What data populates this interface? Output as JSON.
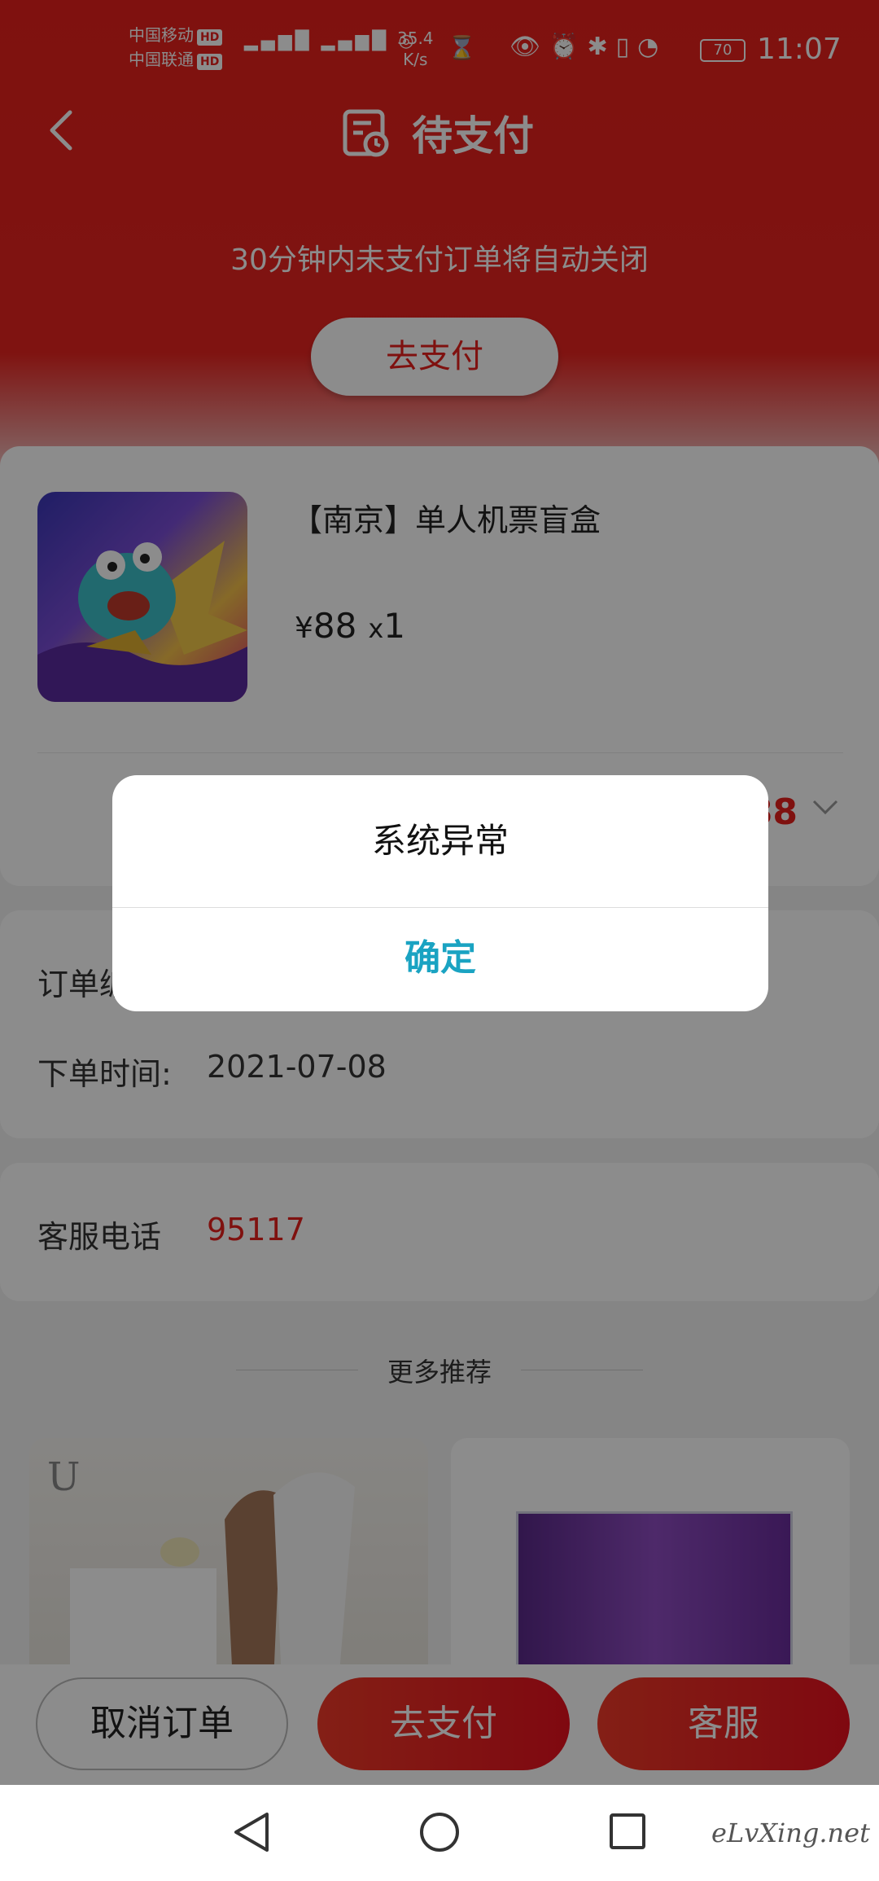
{
  "status_bar": {
    "carrier1": "中国移动",
    "carrier2": "中国联通",
    "hd": "HD",
    "speed_value": "35.4",
    "speed_unit": "K/s",
    "battery": "70",
    "time": "11:07"
  },
  "header": {
    "title": "待支付",
    "subtitle": "30分钟内未支付订单将自动关闭",
    "pay_button": "去支付"
  },
  "product": {
    "name": "【南京】单人机票盲盒",
    "currency": "¥",
    "price": "88",
    "qty_prefix": "x",
    "qty": "1",
    "total_visible": "88"
  },
  "order_info": {
    "order_no_label": "订单编号:",
    "order_time_label": "下单时间:",
    "order_time": "2021-07-08"
  },
  "service": {
    "label": "客服电话",
    "phone": "95117"
  },
  "more": {
    "label": "更多推荐"
  },
  "recommend": {
    "logo": "U"
  },
  "bottom_bar": {
    "cancel": "取消订单",
    "pay": "去支付",
    "service": "客服"
  },
  "dialog": {
    "message": "系统异常",
    "ok": "确定"
  },
  "watermark": "eLvXing.net",
  "colors": {
    "brand_red": "#e8201c",
    "dialog_ok": "#1aa3c2"
  }
}
